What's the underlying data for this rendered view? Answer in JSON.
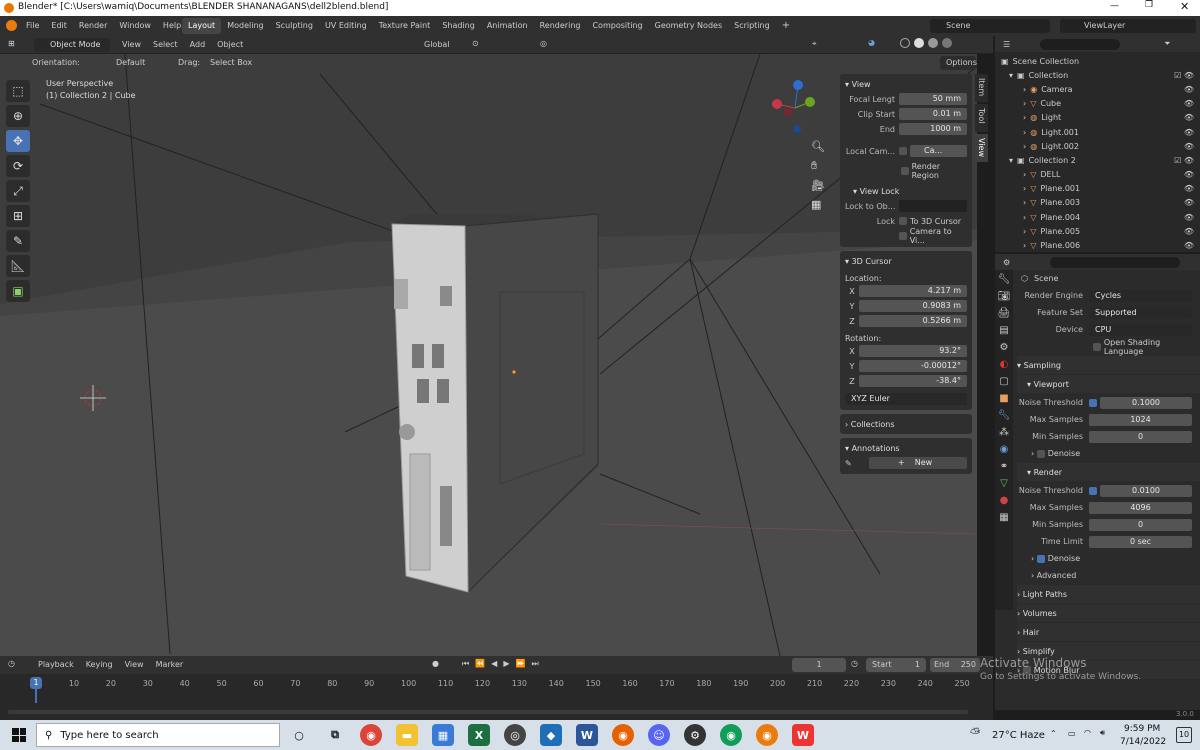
{
  "window": {
    "title": "Blender* [C:\\Users\\wamiq\\Documents\\BLENDER SHANANAGANS\\dell2blend.blend]"
  },
  "menu": {
    "items": [
      "File",
      "Edit",
      "Render",
      "Window",
      "Help"
    ],
    "workspaces": [
      "Layout",
      "Modeling",
      "Sculpting",
      "UV Editing",
      "Texture Paint",
      "Shading",
      "Animation",
      "Rendering",
      "Compositing",
      "Geometry Nodes",
      "Scripting"
    ],
    "add": "+",
    "scene": "Scene",
    "view_layer": "ViewLayer"
  },
  "header3d": {
    "mode": "Object Mode",
    "menus": [
      "View",
      "Select",
      "Add",
      "Object"
    ],
    "transform": "Global",
    "orientation_label": "Orientation:",
    "orientation_value": "Default",
    "drag_label": "Drag:",
    "drag_value": "Select Box",
    "options": "Options"
  },
  "viewport": {
    "perspective": "User Perspective",
    "object": "(1) Collection 2 | Cube"
  },
  "npanel": {
    "tabs": [
      "Item",
      "Tool",
      "View"
    ],
    "view_title": "View",
    "focal_label": "Focal Lengt",
    "focal": "50 mm",
    "clip_start_label": "Clip Start",
    "clip_start": "0.01 m",
    "end_label": "End",
    "clip_end": "1000 m",
    "local_camera_label": "Local Cam...",
    "local_camera_value": "Ca...",
    "render_region": "Render Region",
    "view_lock_title": "View Lock",
    "lock_obj_label": "Lock to Ob...",
    "lock_label": "Lock",
    "to_3d_cursor": "To 3D Cursor",
    "camera_to_view": "Camera to Vi...",
    "cursor_title": "3D Cursor",
    "location_label": "Location:",
    "loc_x": "4.217 m",
    "loc_y": "0.9083 m",
    "loc_z": "0.5266 m",
    "rotation_label": "Rotation:",
    "rot_x": "93.2°",
    "rot_y": "-0.00012°",
    "rot_z": "-38.4°",
    "euler": "XYZ Euler",
    "collections": "Collections",
    "annotations": "Annotations",
    "new": "New"
  },
  "outliner": {
    "root": "Scene Collection",
    "rows": [
      "Collection",
      "Camera",
      "Cube",
      "Light",
      "Light.001",
      "Light.002",
      "Collection 2",
      "DELL",
      "Plane.001",
      "Plane.003",
      "Plane.004",
      "Plane.005",
      "Plane.006"
    ]
  },
  "properties": {
    "scene": "Scene",
    "engine_label": "Render Engine",
    "engine": "Cycles",
    "feature_label": "Feature Set",
    "feature": "Supported",
    "device_label": "Device",
    "device": "CPU",
    "osl": "Open Shading Language",
    "sampling": "Sampling",
    "viewport": "Viewport",
    "noise_label": "Noise Threshold",
    "vp_noise": "0.1000",
    "max_label": "Max Samples",
    "vp_max": "1024",
    "min_label": "Min Samples",
    "vp_min": "0",
    "denoise": "Denoise",
    "render": "Render",
    "r_noise": "0.0100",
    "r_max": "4096",
    "r_min": "0",
    "time_label": "Time Limit",
    "time": "0 sec",
    "advanced": "Advanced",
    "light_paths": "Light Paths",
    "volumes": "Volumes",
    "hair": "Hair",
    "simplify": "Simplify",
    "motion_blur": "Motion Blur"
  },
  "timeline": {
    "menus": [
      "Playback",
      "Keying",
      "View",
      "Marker"
    ],
    "current": "1",
    "start_label": "Start",
    "start": "1",
    "end_label": "End",
    "end": "250",
    "ticks": [
      "1",
      "10",
      "20",
      "30",
      "40",
      "50",
      "60",
      "70",
      "80",
      "90",
      "100",
      "110",
      "120",
      "130",
      "140",
      "150",
      "160",
      "170",
      "180",
      "190",
      "200",
      "210",
      "220",
      "230",
      "240",
      "250"
    ]
  },
  "watermark": {
    "line1": "Activate Windows",
    "line2": "Go to Settings to activate Windows."
  },
  "version": "3.0.0",
  "taskbar": {
    "search": "Type here to search",
    "weather": "27°C  Haze",
    "time": "9:59 PM",
    "date": "7/14/2022",
    "notif": "10"
  }
}
